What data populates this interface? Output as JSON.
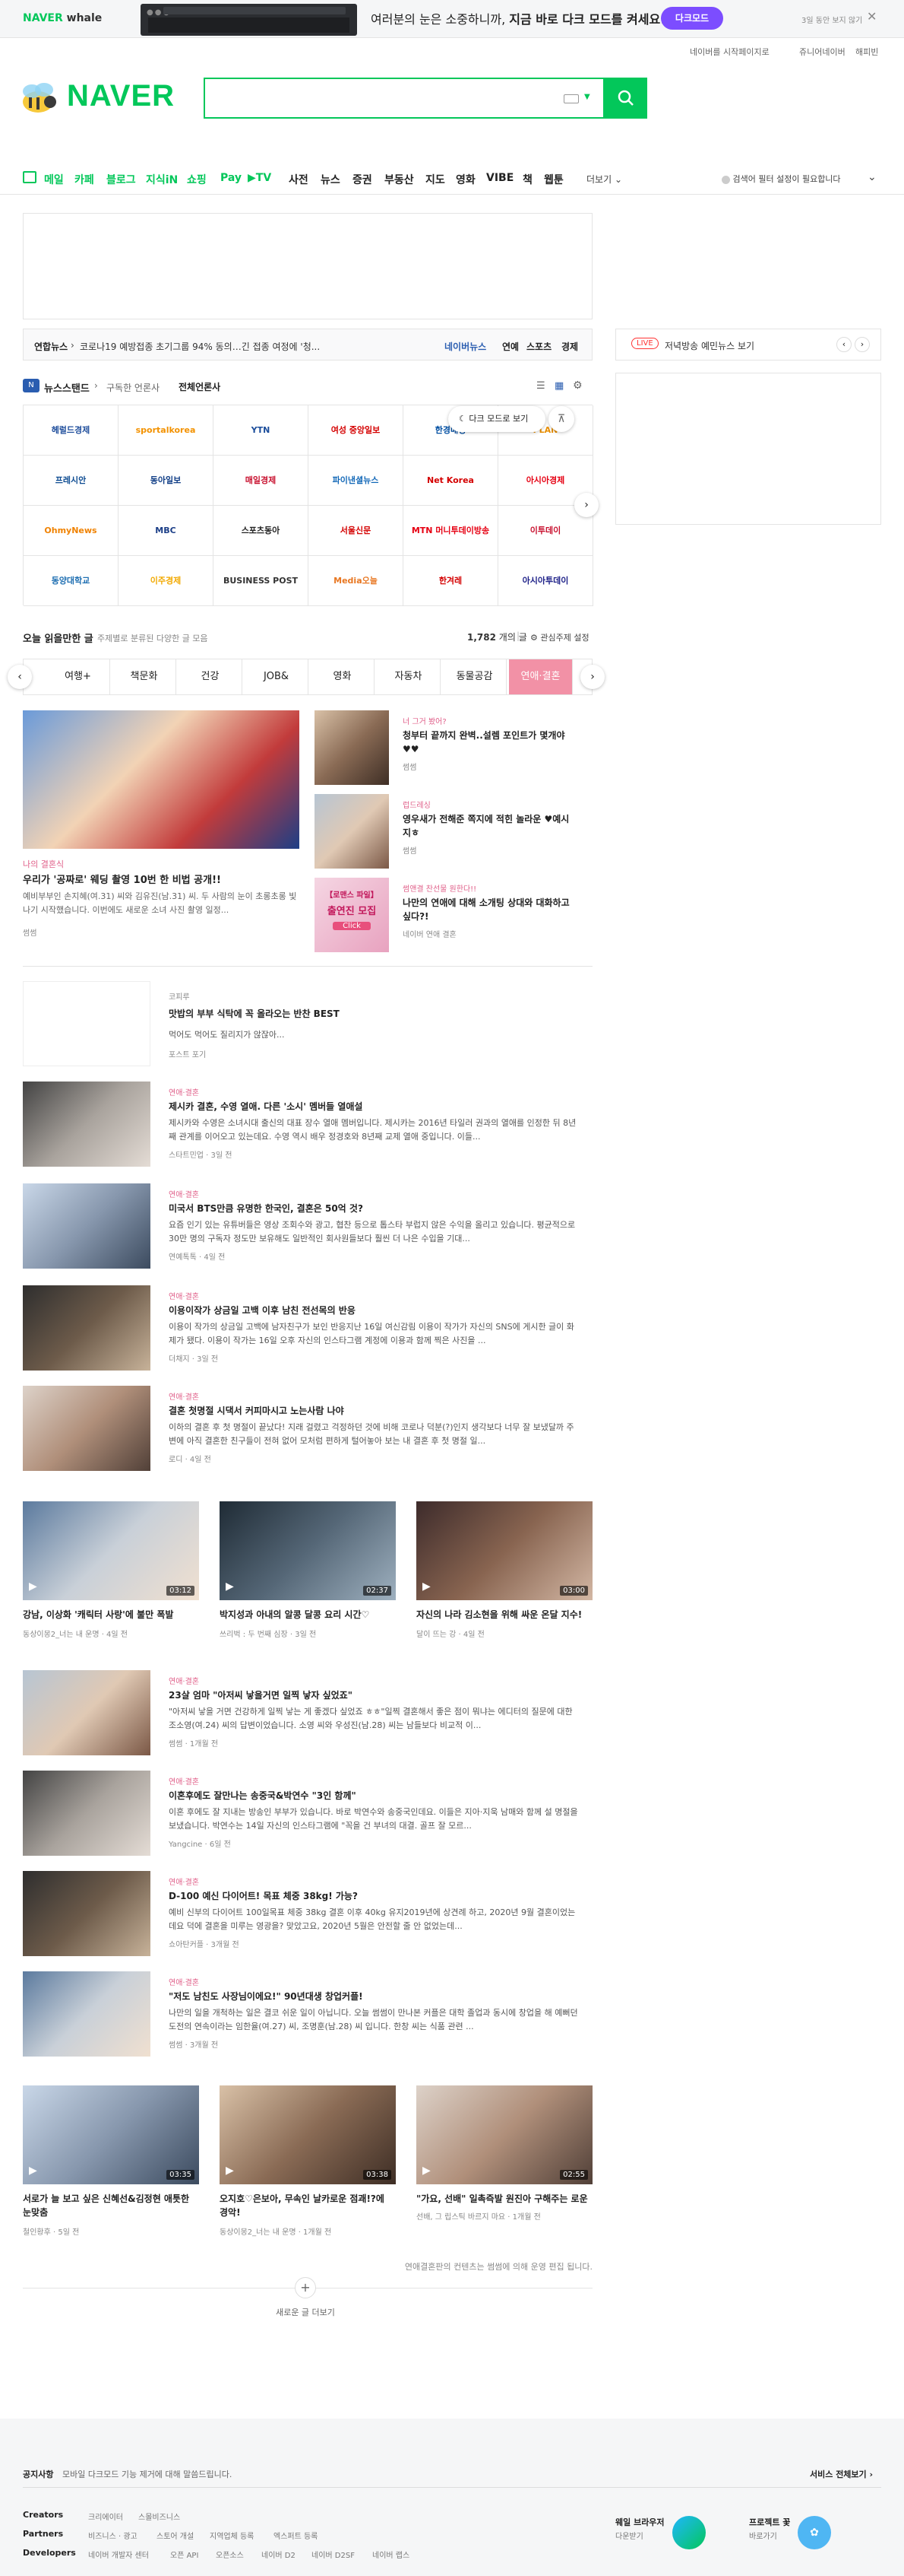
{
  "banner": {
    "whale_brand": "NAVER",
    "whale_name": "whale",
    "text_normal": "여러분의 눈은 소중하니까, ",
    "text_bold": "지금 바로 다크 모드를 켜세요!",
    "dark_button": "다크모드",
    "hide_text": "3일 동안 보지 않기",
    "close": "✕"
  },
  "util_links": [
    "네이버를 시작페이지로",
    "쥬니어네이버",
    "해피빈"
  ],
  "logo": "NAVER",
  "search": {
    "value": "",
    "placeholder": ""
  },
  "nav": {
    "items": [
      {
        "label": "메일",
        "color": "#03c75a"
      },
      {
        "label": "카페",
        "color": "#03c75a"
      },
      {
        "label": "블로그",
        "color": "#03c75a"
      },
      {
        "label": "지식iN",
        "color": "#03c75a"
      },
      {
        "label": "쇼핑",
        "color": "#03c75a"
      },
      {
        "label": "Pay",
        "color": "#03c75a"
      },
      {
        "label": "▶TV",
        "color": "#03c75a"
      },
      {
        "label": "사전",
        "color": "#222222"
      },
      {
        "label": "뉴스",
        "color": "#222222"
      },
      {
        "label": "증권",
        "color": "#222222"
      },
      {
        "label": "부동산",
        "color": "#222222"
      },
      {
        "label": "지도",
        "color": "#222222"
      },
      {
        "label": "영화",
        "color": "#222222"
      },
      {
        "label": "VIBE",
        "color": "#222222"
      },
      {
        "label": "책",
        "color": "#222222"
      },
      {
        "label": "웹툰",
        "color": "#222222"
      }
    ],
    "more": "더보기",
    "filter_notice": "검색어 필터 설정이 필요합니다"
  },
  "ticker": {
    "source": "연합뉴스",
    "headline": "코로나19 예방접종 초기그룹 94% 동의…긴 접종 여정에 '청...",
    "link": "네이버뉴스",
    "tabs": [
      "연예",
      "스포츠",
      "경제"
    ]
  },
  "live": {
    "badge": "LIVE",
    "text": "저녁방송 예민뉴스 보기",
    "prev": "‹",
    "next": "›"
  },
  "newsstand": {
    "icon_text": "N",
    "title": "뉴스스탠드",
    "subscribed": "구독한 언론사",
    "all": "전체언론사",
    "dark_tip": "다크 모드로 보기",
    "press": [
      "헤럴드경제",
      "sportalkorea",
      "YTN",
      "여성 중앙일보",
      "한경매경",
      "PLAN",
      "프레시안",
      "동아일보",
      "매일경제",
      "파이낸셜뉴스",
      "Net Korea",
      "아시아경제",
      "OhmyNews",
      "MBC",
      "스포츠동아",
      "서울신문",
      "MTN 머니투데이방송",
      "이투데이",
      "동양대학교",
      "이주경제",
      "BUSINESS POST",
      "Media오늘",
      "한겨레",
      "아시아투데이"
    ]
  },
  "today": {
    "title": "오늘 읽을만한 글",
    "subtitle": "주제별로 분류된 다양한 글 모음",
    "count": "1,782",
    "count_suffix": "개의 글",
    "setting": "관심주제 설정",
    "categories": [
      "여행+",
      "책문화",
      "건강",
      "JOB&",
      "영화",
      "자동차",
      "동물공감",
      "연애·결혼"
    ]
  },
  "featured": {
    "category": "나의 결혼식",
    "title": "우리가 '공짜로' 웨딩 촬영 10번 한 비법 공개!!",
    "desc": "예비부부인 손지혜(여.31) 씨와 김유진(남.31) 씨. 두 사람의 눈이 초롱초롱 빛나기 시작했습니다. 이번에도 새로운 소녀 사진 촬영 일정...",
    "source": "썸썸"
  },
  "side_cards": [
    {
      "category": "너 그거 봤어?",
      "title": "청부터 끝까지 완벽..설렘 포인트가 몇개야♥♥",
      "source": "썸썸"
    },
    {
      "category": "럽드레싱",
      "title": "영우새가 전해준 쪽지에 적힌 놀라운 ♥예시지ㅎ",
      "source": "썸썸"
    },
    {
      "category": "썸앤결 찬선물 원한다!!",
      "title": "나만의 연애에 대해 소개팅 상대와 대화하고 싶다?!",
      "source": "네이버 연애 결혼",
      "promo_title": "【로맨스 파일】",
      "promo_sub": "출연진 모집",
      "promo_click": "Click"
    }
  ],
  "best_card": {
    "label": "코피루",
    "title": "맛밥의 부부 식탁에 꼭 올라오는 반찬 BEST",
    "desc": "먹어도 먹어도 질리지가 않잖아...",
    "source": "포스트 포기"
  },
  "rows_a": [
    {
      "category": "연애·결혼",
      "title": "제시카 결혼, 수영 열애. 다른 '소시' 멤버들 열애설",
      "desc": "제시카와 수영은 소녀시대 출신의 대표 장수 열애 멤버입니다. 제시카는 2016년 타일러 권과의 열애를 인정한 뒤 8년째 관계를 이어오고 있는데요. 수영 역시 배우 정경호와 8년째 교제 열애 중입니다. 이들...",
      "source": "스타트민업 · 3일 전"
    },
    {
      "category": "연애·결혼",
      "title": "미국서 BTS만큼 유명한 한국인, 결혼은 50억 것?",
      "desc": "요즘 인기 있는 유튜버들은 영상 조회수와 광고, 협찬 등으로 톱스타 부럽지 않은 수익을 올리고 있습니다. 평균적으로 30만 명의 구독자 정도만 보유해도 일반적인 회사원들보다 훨씬 더 나은 수입을 기대...",
      "source": "연예톡톡 · 4일 전"
    },
    {
      "category": "연애·결혼",
      "title": "이용이작가 상금일 고백 이후 남친 전선목의 반응",
      "desc": "이용이 작가의 상금일 고백에 남자친구가 보인 반응지난 16일 여신감림 이용이 작가가 자신의 SNS에 게시한 글이 화제가 됐다. 이용이 작가는 16일 오후 자신의 인스타그램 계정에 이용과 함께 찍은 사진을 ...",
      "source": "더채지 · 3일 전"
    },
    {
      "category": "연애·결혼",
      "title": "결혼 첫명절 시댁서 커피마시고 노는사람 나야",
      "desc": "이하의 결혼 후 첫 명절이 끝났다! 지래 걸렸고 걱정하던 것에 비해 코로나 덕분(?)인지 생각보다 너무 잘 보냈달까 주변에 아직 결혼한 친구들이 전혀 없어 모처럼 편하게 털어놓아 보는 내 결혼 후 첫 명절 일...",
      "source": "로디 · 4일 전"
    }
  ],
  "videos_a": [
    {
      "duration": "03:12",
      "title": "강남, 이상화 '캐릭터 사랑'에 불만 폭발",
      "source": "동상이몽2_너는 내 운명 · 4일 전"
    },
    {
      "duration": "02:37",
      "title": "박지성과 아내의 알콩 달콩 요리 시간♡",
      "source": "쓰리벅 : 두 번째 심장 · 3일 전"
    },
    {
      "duration": "03:00",
      "title": "자신의 나라 김소현을 위해 싸운 온달 지수!",
      "source": "달이 뜨는 강 · 4일 전"
    }
  ],
  "rows_b": [
    {
      "category": "연애·결혼",
      "title": "23살 엄마 \"아저씨 낳을거면 일찍 낳자 싶었죠\"",
      "desc": "\"아저씨 낳을 거면 건강하게 일찍 낳는 게 좋겠다 싶었죠 ㅎㅎ\"일찍 결혼해서 좋은 점이 뭐냐는 에디터의 질문에 대한 조소영(여.24) 씨의 답변이었습니다. 소영 씨와 우성진(남.28) 씨는 남들보다 비교적 이...",
      "source": "썸썸 · 1개월 전"
    },
    {
      "category": "연애·결혼",
      "title": "이혼후에도 잘만나는 송중국&박연수 \"3인 함께\"",
      "desc": "이혼 후에도 잘 지내는 방송인 부부가 있습니다. 바로 박연수와 송중국인데요. 이들은 지아·지욱 남매와 함께 설 명절을 보냈습니다. 박연수는 14일 자신의 인스타그램에 \"꼭을 건 부녀의 대결. 골프 잘 모르...",
      "source": "Yangcine · 6일 전"
    },
    {
      "category": "연애·결혼",
      "title": "D-100 예신 다이어트! 목표 체중 38kg! 가능?",
      "desc": "예비 신부의 다이어트 100일목표 체중 38kg 결혼 이후 40kg 유지2019년에 상견례 하고, 2020년 9월 결혼이었는데요 덕에 결혼을 미루는 영광을? 맞았고요, 2020년 5월은 안전할 줄 안 없었는데...",
      "source": "쇼아탄커플 · 3개월 전"
    },
    {
      "category": "연애·결혼",
      "title": "\"저도 남친도 사장님이에요!\" 90년대생 창업커플!",
      "desc": "나만의 일을 개척하는 일은 결코 쉬운 일이 아닙니다. 오늘 썸썸이 만나본 커플은 대학 졸업과 동시에 창업을 해 예뻐던 도전의 연속이라는 임한율(여.27) 씨, 조명훈(남.28) 씨 입니다. 한창 씨는 식품 관련 ...",
      "source": "썸썸 · 3개월 전"
    }
  ],
  "videos_b": [
    {
      "duration": "03:35",
      "title": "서로가 늘 보고 싶은 신혜선&김정현 애틋한 눈맞춤",
      "source": "철인황후 · 5일 전"
    },
    {
      "duration": "03:38",
      "title": "오지호♡은보아, 무속인 날카로운 점괘!?에 경악!",
      "source": "동상이몽2_너는 내 운명 · 1개월 전"
    },
    {
      "duration": "02:55",
      "title": "\"가요, 선배\" 일촉즉발 원진아 구해주는 로운",
      "source": "선배, 그 립스틱 바르지 마요 · 1개월 전"
    }
  ],
  "more": {
    "note": "연애결혼판의 컨텐츠는 썸썸에 의해 운영 편집 됩니다.",
    "plus": "+",
    "label": "새로운 글 더보기"
  },
  "footer": {
    "notice_label": "공지사항",
    "notice_text": "모바일 다크모드 기능 제거에 대해 말씀드립니다.",
    "services_all": "서비스 전체보기",
    "rows": [
      {
        "label": "Creators",
        "links": [
          "크리에이터",
          "스몰비즈니스"
        ]
      },
      {
        "label": "Partners",
        "links": [
          "비즈니스 · 광고",
          "스토어 개설",
          "지역업체 등록",
          "엑스퍼트 등록"
        ]
      },
      {
        "label": "Developers",
        "links": [
          "네이버 개발자 센터",
          "오픈 API",
          "오픈소스",
          "네이버 D2",
          "네이버 D2SF",
          "네이버 랩스"
        ]
      }
    ],
    "whale_app": "웨일 브라우저",
    "whale_app_sub": "다운받기",
    "project": "프로젝트 꽃",
    "project_sub": "바로가기"
  }
}
